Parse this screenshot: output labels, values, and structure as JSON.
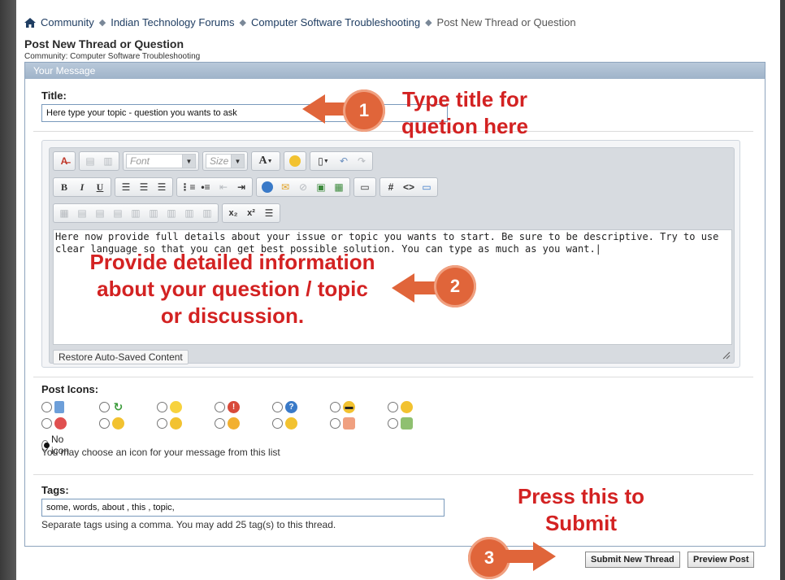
{
  "breadcrumb": {
    "items": [
      "Community",
      "Indian Technology Forums",
      "Computer Software Troubleshooting"
    ],
    "current": "Post New Thread or Question"
  },
  "page": {
    "title": "Post New Thread or Question",
    "community": "Community: Computer Software Troubleshooting"
  },
  "panel": {
    "header": "Your Message"
  },
  "title_field": {
    "label": "Title:",
    "value": "Here type your topic - question you wants to ask"
  },
  "toolbar": {
    "font_placeholder": "Font",
    "size_placeholder": "Size",
    "font_color_label": "A",
    "bold": "B",
    "italic": "I",
    "underline": "U",
    "hash": "#",
    "code": "<>",
    "subscript": "x₂",
    "superscript": "x²"
  },
  "message": {
    "text": "Here now provide full details about your issue or topic you wants to start. Be sure to be descriptive. Try to use clear language so that you can get best possible solution. You can type as much as you want.",
    "restore_label": "Restore Auto-Saved Content"
  },
  "post_icons": {
    "label": "Post Icons:",
    "no_icon_label": "No icon",
    "help": "You may choose an icon for your message from this list",
    "icons": [
      "document-icon",
      "recycle-icon",
      "lightbulb-icon",
      "exclamation-icon",
      "question-icon",
      "cool-face-icon",
      "smile-icon",
      "angry-face-icon",
      "frown-icon",
      "surprised-icon",
      "happy-icon",
      "grin-icon",
      "thumbs-down-icon",
      "thumbs-up-icon"
    ]
  },
  "tags": {
    "label": "Tags:",
    "value": "some, words, about , this , topic,",
    "help": "Separate tags using a comma. You may add 25 tag(s) to this thread."
  },
  "actions": {
    "submit_label": "Submit New Thread",
    "preview_label": "Preview Post"
  },
  "annotations": {
    "step1_number": "1",
    "step1_text_line1": "Type title for",
    "step1_text_line2": "quetion here",
    "step2_number": "2",
    "step2_text_line1": "Provide detailed information",
    "step2_text_line2": "about your question / topic",
    "step2_text_line3": "or discussion.",
    "step3_number": "3",
    "step3_text_line1": "Press this to",
    "step3_text_line2": "Submit"
  },
  "colors": {
    "annotation_text": "#d32222",
    "annotation_circle": "#e0653a",
    "panel_header": "#9fb3c9",
    "breadcrumb_link": "#1f3d62"
  }
}
